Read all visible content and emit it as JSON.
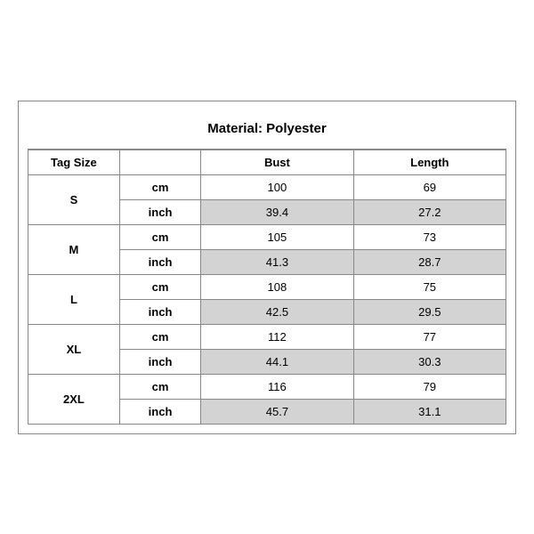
{
  "title": "Material: Polyester",
  "headers": {
    "tag_size": "Tag Size",
    "bust": "Bust",
    "length": "Length"
  },
  "rows": [
    {
      "size": "S",
      "cm": {
        "bust": "100",
        "length": "69"
      },
      "inch": {
        "bust": "39.4",
        "length": "27.2"
      }
    },
    {
      "size": "M",
      "cm": {
        "bust": "105",
        "length": "73"
      },
      "inch": {
        "bust": "41.3",
        "length": "28.7"
      }
    },
    {
      "size": "L",
      "cm": {
        "bust": "108",
        "length": "75"
      },
      "inch": {
        "bust": "42.5",
        "length": "29.5"
      }
    },
    {
      "size": "XL",
      "cm": {
        "bust": "112",
        "length": "77"
      },
      "inch": {
        "bust": "44.1",
        "length": "30.3"
      }
    },
    {
      "size": "2XL",
      "cm": {
        "bust": "116",
        "length": "79"
      },
      "inch": {
        "bust": "45.7",
        "length": "31.1"
      }
    }
  ],
  "units": {
    "cm": "cm",
    "inch": "inch"
  }
}
